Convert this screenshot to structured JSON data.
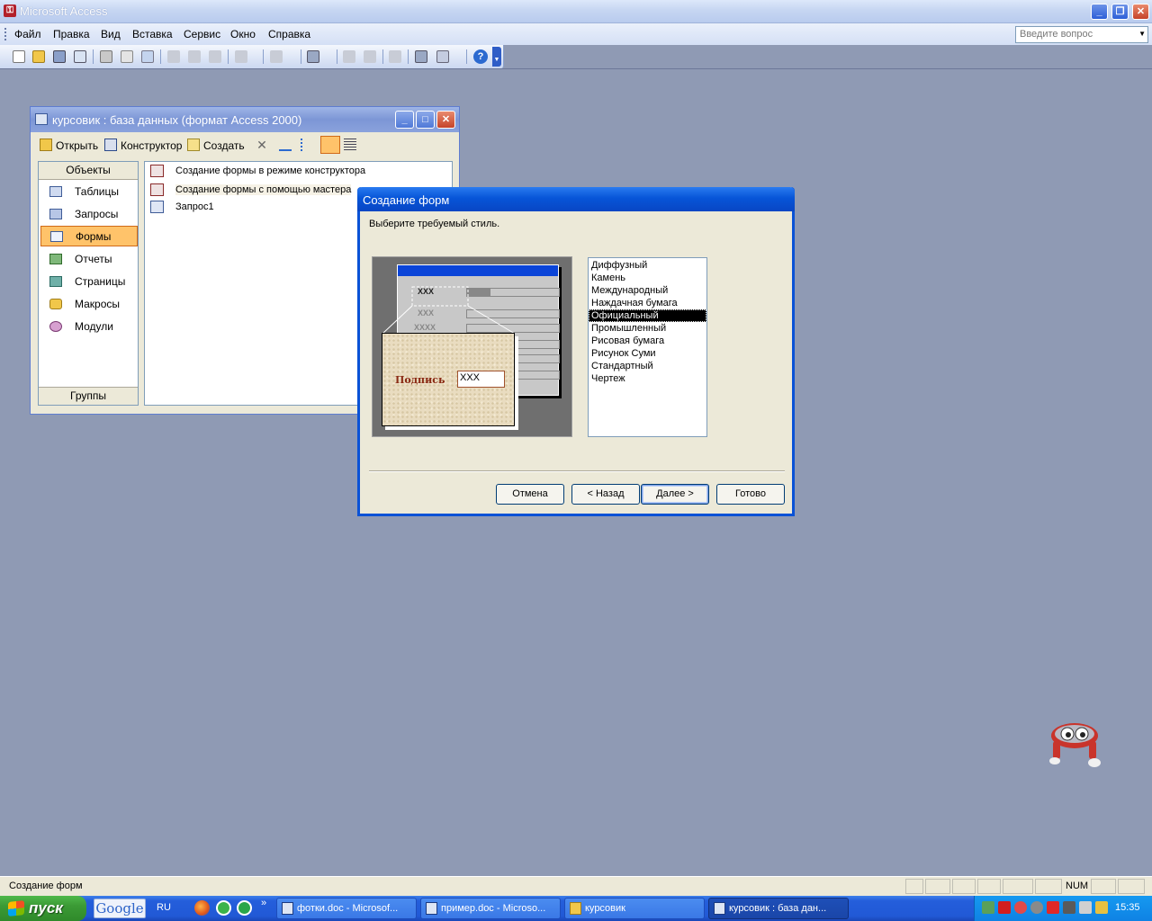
{
  "app": {
    "title": "Microsoft Access",
    "icon": "access-key-icon"
  },
  "menu": {
    "items": [
      {
        "label": "Файл"
      },
      {
        "label": "Правка"
      },
      {
        "label": "Вид"
      },
      {
        "label": "Вставка"
      },
      {
        "label": "Сервис"
      },
      {
        "label": "Окно"
      },
      {
        "label": "Справка"
      }
    ],
    "help_placeholder": "Введите вопрос"
  },
  "db_window": {
    "title": "курсовик : база данных (формат Access 2000)",
    "toolbar": {
      "open": "Открыть",
      "design": "Конструктор",
      "create": "Создать"
    },
    "objects_header": "Объекты",
    "groups_footer": "Группы",
    "objects": [
      {
        "label": "Таблицы",
        "selected": false
      },
      {
        "label": "Запросы",
        "selected": false
      },
      {
        "label": "Формы",
        "selected": true
      },
      {
        "label": "Отчеты",
        "selected": false
      },
      {
        "label": "Страницы",
        "selected": false
      },
      {
        "label": "Макросы",
        "selected": false
      },
      {
        "label": "Модули",
        "selected": false
      }
    ],
    "list": [
      {
        "label": "Создание формы в режиме конструктора"
      },
      {
        "label": "Создание формы с помощью мастера"
      },
      {
        "label": "Запрос1"
      }
    ]
  },
  "wizard": {
    "title": "Создание форм",
    "prompt": "Выберите требуемый стиль.",
    "preview": {
      "row_labels": [
        "XXX",
        "XXX",
        "XXXX"
      ],
      "zoom_label": "Подпись",
      "zoom_value": "XXX"
    },
    "styles": [
      "Диффузный",
      "Камень",
      "Международный",
      "Наждачная бумага",
      "Официальный",
      "Промышленный",
      "Рисовая бумага",
      "Рисунок Суми",
      "Стандартный",
      "Чертеж"
    ],
    "selected_style": "Официальный",
    "buttons": {
      "cancel": "Отмена",
      "back": "< Назад",
      "next": "Далее >",
      "finish": "Готово"
    }
  },
  "status": {
    "text": "Создание форм",
    "num": "NUM"
  },
  "taskbar": {
    "start": "пуск",
    "google": "Google",
    "lang": "RU",
    "more": "»",
    "tasks": [
      {
        "label": "фотки.doc - Microsof...",
        "active": false
      },
      {
        "label": "пример.doc - Microso...",
        "active": false
      },
      {
        "label": "курсовик",
        "active": false
      },
      {
        "label": "курсовик : база дан...",
        "active": true
      }
    ],
    "clock": "15:35"
  },
  "colors": {
    "desktop": "#8f9ab4",
    "wizard_caption": "#0755d8",
    "selected_object": "#ffc36a"
  }
}
